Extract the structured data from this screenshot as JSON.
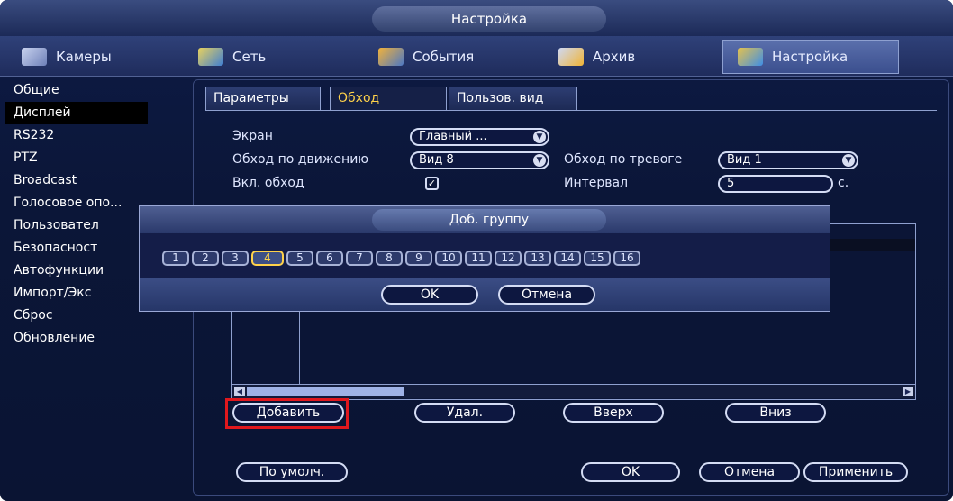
{
  "window": {
    "title": "Настройка"
  },
  "main_tabs": [
    {
      "label": "Камеры",
      "icon": "camera-icon"
    },
    {
      "label": "Сеть",
      "icon": "network-icon"
    },
    {
      "label": "События",
      "icon": "events-icon"
    },
    {
      "label": "Архив",
      "icon": "archive-icon"
    },
    {
      "label": "Настройка",
      "icon": "settings-icon",
      "active": true
    }
  ],
  "sidebar": {
    "items": [
      {
        "label": "Общие"
      },
      {
        "label": "Дисплей",
        "active": true
      },
      {
        "label": "RS232"
      },
      {
        "label": "PTZ"
      },
      {
        "label": "Broadcast"
      },
      {
        "label": "Голосовое опо..."
      },
      {
        "label": "Пользовател"
      },
      {
        "label": "Безопасност"
      },
      {
        "label": "Автофункции"
      },
      {
        "label": "Импорт/Экс"
      },
      {
        "label": "Сброс"
      },
      {
        "label": "Обновление"
      }
    ]
  },
  "sub_tabs": [
    {
      "label": "Параметры"
    },
    {
      "label": "Обход",
      "active": true
    },
    {
      "label": "Пользов. вид"
    }
  ],
  "form": {
    "screen_label": "Экран",
    "screen_value": "Главный ...",
    "motion_tour_label": "Обход по движению",
    "motion_tour_value": "Вид 8",
    "alarm_tour_label": "Обход по тревоге",
    "alarm_tour_value": "Вид 1",
    "enable_tour_label": "Вкл. обход",
    "interval_label": "Интервал",
    "interval_value": "5",
    "interval_unit": "с."
  },
  "list_buttons": {
    "add": "Добавить",
    "delete": "Удал.",
    "up": "Вверх",
    "down": "Вниз"
  },
  "footer_buttons": {
    "default": "По умолч.",
    "ok": "OK",
    "cancel": "Отмена",
    "apply": "Применить"
  },
  "dialog": {
    "title": "Доб. группу",
    "channels": [
      "1",
      "2",
      "3",
      "4",
      "5",
      "6",
      "7",
      "8",
      "9",
      "10",
      "11",
      "12",
      "13",
      "14",
      "15",
      "16"
    ],
    "selected_channel": "4",
    "ok": "OK",
    "cancel": "Отмена"
  },
  "colors": {
    "highlight": "#e0181d",
    "selected": "#ffd24a",
    "background": "#0b1638"
  }
}
